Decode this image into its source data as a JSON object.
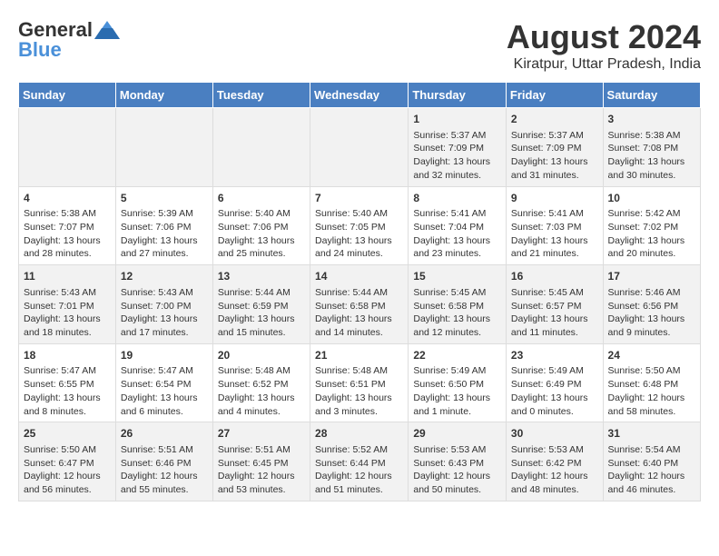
{
  "logo": {
    "general": "General",
    "blue": "Blue"
  },
  "title": {
    "month_year": "August 2024",
    "location": "Kiratpur, Uttar Pradesh, India"
  },
  "days_of_week": [
    "Sunday",
    "Monday",
    "Tuesday",
    "Wednesday",
    "Thursday",
    "Friday",
    "Saturday"
  ],
  "weeks": [
    [
      {
        "day": "",
        "content": ""
      },
      {
        "day": "",
        "content": ""
      },
      {
        "day": "",
        "content": ""
      },
      {
        "day": "",
        "content": ""
      },
      {
        "day": "1",
        "content": "Sunrise: 5:37 AM\nSunset: 7:09 PM\nDaylight: 13 hours\nand 32 minutes."
      },
      {
        "day": "2",
        "content": "Sunrise: 5:37 AM\nSunset: 7:09 PM\nDaylight: 13 hours\nand 31 minutes."
      },
      {
        "day": "3",
        "content": "Sunrise: 5:38 AM\nSunset: 7:08 PM\nDaylight: 13 hours\nand 30 minutes."
      }
    ],
    [
      {
        "day": "4",
        "content": "Sunrise: 5:38 AM\nSunset: 7:07 PM\nDaylight: 13 hours\nand 28 minutes."
      },
      {
        "day": "5",
        "content": "Sunrise: 5:39 AM\nSunset: 7:06 PM\nDaylight: 13 hours\nand 27 minutes."
      },
      {
        "day": "6",
        "content": "Sunrise: 5:40 AM\nSunset: 7:06 PM\nDaylight: 13 hours\nand 25 minutes."
      },
      {
        "day": "7",
        "content": "Sunrise: 5:40 AM\nSunset: 7:05 PM\nDaylight: 13 hours\nand 24 minutes."
      },
      {
        "day": "8",
        "content": "Sunrise: 5:41 AM\nSunset: 7:04 PM\nDaylight: 13 hours\nand 23 minutes."
      },
      {
        "day": "9",
        "content": "Sunrise: 5:41 AM\nSunset: 7:03 PM\nDaylight: 13 hours\nand 21 minutes."
      },
      {
        "day": "10",
        "content": "Sunrise: 5:42 AM\nSunset: 7:02 PM\nDaylight: 13 hours\nand 20 minutes."
      }
    ],
    [
      {
        "day": "11",
        "content": "Sunrise: 5:43 AM\nSunset: 7:01 PM\nDaylight: 13 hours\nand 18 minutes."
      },
      {
        "day": "12",
        "content": "Sunrise: 5:43 AM\nSunset: 7:00 PM\nDaylight: 13 hours\nand 17 minutes."
      },
      {
        "day": "13",
        "content": "Sunrise: 5:44 AM\nSunset: 6:59 PM\nDaylight: 13 hours\nand 15 minutes."
      },
      {
        "day": "14",
        "content": "Sunrise: 5:44 AM\nSunset: 6:58 PM\nDaylight: 13 hours\nand 14 minutes."
      },
      {
        "day": "15",
        "content": "Sunrise: 5:45 AM\nSunset: 6:58 PM\nDaylight: 13 hours\nand 12 minutes."
      },
      {
        "day": "16",
        "content": "Sunrise: 5:45 AM\nSunset: 6:57 PM\nDaylight: 13 hours\nand 11 minutes."
      },
      {
        "day": "17",
        "content": "Sunrise: 5:46 AM\nSunset: 6:56 PM\nDaylight: 13 hours\nand 9 minutes."
      }
    ],
    [
      {
        "day": "18",
        "content": "Sunrise: 5:47 AM\nSunset: 6:55 PM\nDaylight: 13 hours\nand 8 minutes."
      },
      {
        "day": "19",
        "content": "Sunrise: 5:47 AM\nSunset: 6:54 PM\nDaylight: 13 hours\nand 6 minutes."
      },
      {
        "day": "20",
        "content": "Sunrise: 5:48 AM\nSunset: 6:52 PM\nDaylight: 13 hours\nand 4 minutes."
      },
      {
        "day": "21",
        "content": "Sunrise: 5:48 AM\nSunset: 6:51 PM\nDaylight: 13 hours\nand 3 minutes."
      },
      {
        "day": "22",
        "content": "Sunrise: 5:49 AM\nSunset: 6:50 PM\nDaylight: 13 hours\nand 1 minute."
      },
      {
        "day": "23",
        "content": "Sunrise: 5:49 AM\nSunset: 6:49 PM\nDaylight: 13 hours\nand 0 minutes."
      },
      {
        "day": "24",
        "content": "Sunrise: 5:50 AM\nSunset: 6:48 PM\nDaylight: 12 hours\nand 58 minutes."
      }
    ],
    [
      {
        "day": "25",
        "content": "Sunrise: 5:50 AM\nSunset: 6:47 PM\nDaylight: 12 hours\nand 56 minutes."
      },
      {
        "day": "26",
        "content": "Sunrise: 5:51 AM\nSunset: 6:46 PM\nDaylight: 12 hours\nand 55 minutes."
      },
      {
        "day": "27",
        "content": "Sunrise: 5:51 AM\nSunset: 6:45 PM\nDaylight: 12 hours\nand 53 minutes."
      },
      {
        "day": "28",
        "content": "Sunrise: 5:52 AM\nSunset: 6:44 PM\nDaylight: 12 hours\nand 51 minutes."
      },
      {
        "day": "29",
        "content": "Sunrise: 5:53 AM\nSunset: 6:43 PM\nDaylight: 12 hours\nand 50 minutes."
      },
      {
        "day": "30",
        "content": "Sunrise: 5:53 AM\nSunset: 6:42 PM\nDaylight: 12 hours\nand 48 minutes."
      },
      {
        "day": "31",
        "content": "Sunrise: 5:54 AM\nSunset: 6:40 PM\nDaylight: 12 hours\nand 46 minutes."
      }
    ]
  ]
}
